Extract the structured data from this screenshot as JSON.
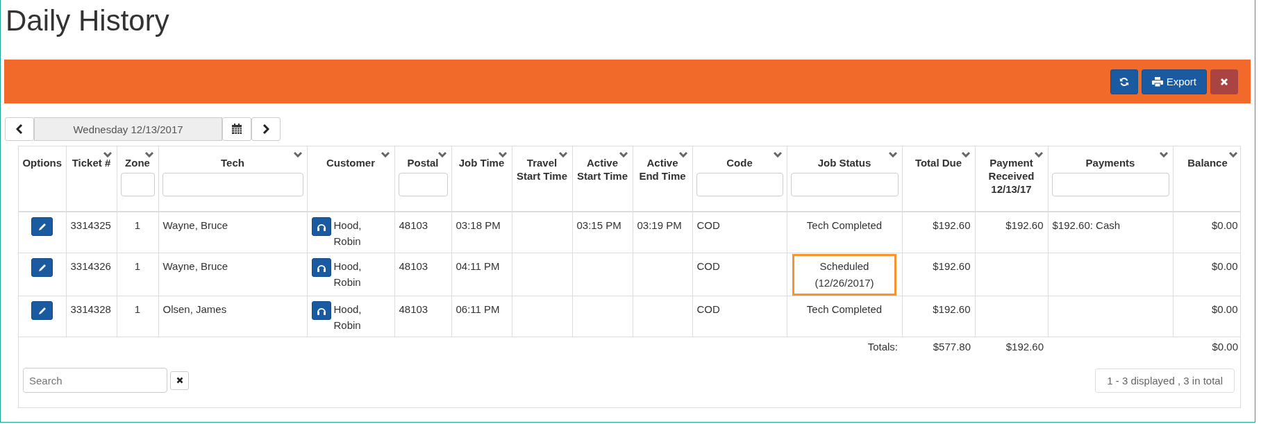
{
  "page_title": "Daily History",
  "toolbar": {
    "export_label": "Export"
  },
  "date_nav": {
    "value": "Wednesday 12/13/2017"
  },
  "table": {
    "columns": [
      {
        "label": "Options",
        "kind": "edit",
        "sortable": false,
        "filter": false
      },
      {
        "label": "Ticket #",
        "kind": "text",
        "sortable": true,
        "filter": false
      },
      {
        "label": "Zone",
        "kind": "text",
        "sortable": true,
        "filter": true
      },
      {
        "label": "Tech",
        "kind": "text",
        "sortable": true,
        "filter": true
      },
      {
        "label": "Customer",
        "kind": "customer",
        "sortable": true,
        "filter": false
      },
      {
        "label": "Postal",
        "kind": "text",
        "sortable": true,
        "filter": true
      },
      {
        "label": "Job Time",
        "kind": "text",
        "sortable": true,
        "filter": false
      },
      {
        "label": "Travel Start Time",
        "kind": "text",
        "sortable": true,
        "filter": false
      },
      {
        "label": "Active Start Time",
        "kind": "text",
        "sortable": true,
        "filter": false
      },
      {
        "label": "Active End Time",
        "kind": "text",
        "sortable": true,
        "filter": false
      },
      {
        "label": "Code",
        "kind": "text",
        "sortable": true,
        "filter": true
      },
      {
        "label": "Job Status",
        "kind": "status",
        "sortable": true,
        "filter": true
      },
      {
        "label": "Total Due",
        "kind": "text",
        "sortable": true,
        "filter": false
      },
      {
        "label": "Payment Received 12/13/17",
        "kind": "text",
        "sortable": true,
        "filter": false
      },
      {
        "label": "Payments",
        "kind": "text",
        "sortable": true,
        "filter": true
      },
      {
        "label": "Balance",
        "kind": "text",
        "sortable": true,
        "filter": false
      }
    ],
    "rows": [
      {
        "highlighted": false,
        "cells": [
          null,
          "3314325",
          "1",
          "Wayne, Bruce",
          "Hood, Robin",
          "48103",
          "03:18 PM",
          null,
          "03:15 PM",
          "03:19 PM",
          "COD",
          "Tech Completed",
          "$192.60",
          "$192.60",
          "$192.60: Cash",
          "$0.00"
        ]
      },
      {
        "highlighted": true,
        "cells": [
          null,
          "3314326",
          "1",
          "Wayne, Bruce",
          "Hood, Robin",
          "48103",
          "04:11 PM",
          null,
          null,
          null,
          "COD",
          "Scheduled (12/26/2017)",
          "$192.60",
          null,
          null,
          "$0.00"
        ]
      },
      {
        "highlighted": false,
        "cells": [
          null,
          "3314328",
          "1",
          "Olsen, James",
          "Hood, Robin",
          "48103",
          "06:11 PM",
          null,
          null,
          null,
          "COD",
          "Tech Completed",
          "$192.60",
          null,
          null,
          "$0.00"
        ]
      }
    ],
    "totals": {
      "label": "Totals:",
      "total_due": "$577.80",
      "payment_received": "$192.60",
      "balance": "$0.00"
    }
  },
  "footer": {
    "search_placeholder": "Search",
    "pager_text": "1 - 3 displayed , 3 in total"
  }
}
